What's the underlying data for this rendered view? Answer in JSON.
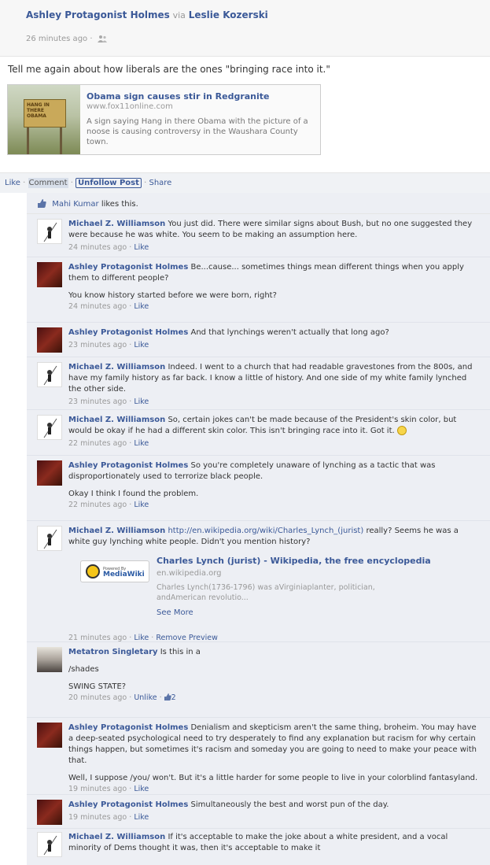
{
  "post": {
    "author": "Ashley Protagonist Holmes",
    "via_label": "via",
    "via_author": "Leslie Kozerski",
    "timestamp": "26 minutes ago",
    "separator": "·",
    "status_text": "Tell me again about how liberals are the ones \"bringing race into it.\""
  },
  "link_card": {
    "title": "Obama sign causes stir in Redgranite",
    "url": "www.fox11online.com",
    "description": "A sign saying Hang in there Obama with the picture of a noose is causing controversy in the Waushara County town.",
    "thumb_text": "HANG IN THERE OBAMA"
  },
  "actions": {
    "like": "Like",
    "comment": "Comment",
    "unfollow": "Unfollow Post",
    "share": "Share",
    "sep": "·"
  },
  "likes": {
    "name": "Mahi Kumar",
    "text": "likes this."
  },
  "comments": [
    {
      "author": "Michael Z. Williamson",
      "text": "You just did. There were similar signs about Bush, but no one suggested they were because he was white. You seem to be making an assumption here.",
      "time": "24 minutes ago",
      "action": "Like"
    },
    {
      "author": "Ashley Protagonist Holmes",
      "text": "Be...cause... sometimes things mean different things when you apply them to different people?",
      "text2": "You know history started before we were born, right?",
      "time": "24 minutes ago",
      "action": "Like"
    },
    {
      "author": "Ashley Protagonist Holmes",
      "text": "And that lynchings weren't actually that long ago?",
      "time": "23 minutes ago",
      "action": "Like"
    },
    {
      "author": "Michael Z. Williamson",
      "text": "Indeed. I went to a church that had readable gravestones from the 800s, and have my family history as far back. I know a little of history. And one side of my white family lynched the other side.",
      "time": "23 minutes ago",
      "action": "Like"
    },
    {
      "author": "Michael Z. Williamson",
      "text": "So, certain jokes can't be made because of the President's skin color, but would be okay if he had a different skin color. This isn't bringing race into it. Got it.",
      "time": "22 minutes ago",
      "action": "Like"
    },
    {
      "author": "Ashley Protagonist Holmes",
      "text": "So you're completely unaware of lynching as a tactic that was disproportionately used to terrorize black people.",
      "text2": "Okay I think I found the problem.",
      "time": "22 minutes ago",
      "action": "Like"
    },
    {
      "author": "Michael Z. Williamson",
      "link": "http://en.wikipedia.org/wiki/Charles_Lynch_(jurist)",
      "text": "really? Seems he was a white guy lynching white people. Didn't you mention history?",
      "time": "21 minutes ago",
      "action": "Like",
      "action2": "Remove Preview"
    },
    {
      "author": "Metatron Singletary",
      "text": "Is this in a",
      "text2": "/shades",
      "text3": "SWING STATE?",
      "time": "20 minutes ago",
      "action": "Unlike",
      "like_count": "2"
    },
    {
      "author": "Ashley Protagonist Holmes",
      "text": "Denialism and skepticism aren't the same thing, broheim. You may have a deep-seated psychological need to try desperately to find any explanation but racism for why certain things happen, but sometimes it's racism and someday you are going to need to make your peace with that.",
      "text2": "Well, I suppose /you/ won't. But it's a little harder for some people to live in your colorblind fantasyland.",
      "time": "19 minutes ago",
      "action": "Like"
    },
    {
      "author": "Ashley Protagonist Holmes",
      "text": "Simultaneously the best and worst pun of the day.",
      "time": "19 minutes ago",
      "action": "Like"
    },
    {
      "author": "Michael Z. Williamson",
      "text": "If it's acceptable to make the joke about a white president, and a vocal minority of Dems thought it was, then it's acceptable to make it",
      "time": "",
      "action": ""
    }
  ],
  "wiki_card": {
    "title": "Charles Lynch (jurist) - Wikipedia, the free encyclopedia",
    "url": "en.wikipedia.org",
    "description": "Charles Lynch(1736-1796) was aVirginiaplanter, politician, andAmerican revolutio...",
    "see_more": "See More",
    "powered_by": "Powered By",
    "mediawiki": "MediaWiki"
  }
}
